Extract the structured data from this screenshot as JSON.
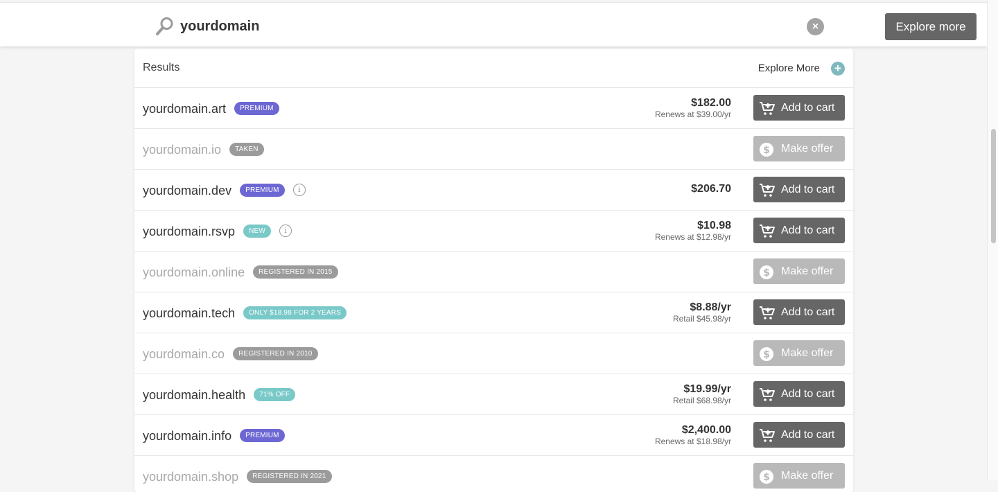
{
  "search": {
    "value": "yourdomain",
    "clear_symbol": "×"
  },
  "header": {
    "explore_button": "Explore more"
  },
  "results": {
    "title": "Results",
    "explore_link": "Explore More",
    "explore_plus": "+",
    "rows": [
      {
        "domain": "yourdomain.art",
        "badge": "PREMIUM",
        "badge_style": "premium",
        "info": false,
        "price": "$182.00",
        "sub": "Renews at $39.00/yr",
        "action": "Add to cart",
        "available": true
      },
      {
        "domain": "yourdomain.io",
        "badge": "TAKEN",
        "badge_style": "gray",
        "info": false,
        "price": "",
        "sub": "",
        "action": "Make offer",
        "available": false
      },
      {
        "domain": "yourdomain.dev",
        "badge": "PREMIUM",
        "badge_style": "premium",
        "info": true,
        "price": "$206.70",
        "sub": "",
        "action": "Add to cart",
        "available": true
      },
      {
        "domain": "yourdomain.rsvp",
        "badge": "NEW",
        "badge_style": "teal",
        "info": true,
        "price": "$10.98",
        "sub": "Renews at $12.98/yr",
        "action": "Add to cart",
        "available": true
      },
      {
        "domain": "yourdomain.online",
        "badge": "REGISTERED IN 2015",
        "badge_style": "gray",
        "info": false,
        "price": "",
        "sub": "",
        "action": "Make offer",
        "available": false
      },
      {
        "domain": "yourdomain.tech",
        "badge": "ONLY $18.98 FOR 2 YEARS",
        "badge_style": "teal",
        "info": false,
        "price": "$8.88/yr",
        "sub": "Retail $45.98/yr",
        "action": "Add to cart",
        "available": true
      },
      {
        "domain": "yourdomain.co",
        "badge": "REGISTERED IN 2010",
        "badge_style": "gray",
        "info": false,
        "price": "",
        "sub": "",
        "action": "Make offer",
        "available": false
      },
      {
        "domain": "yourdomain.health",
        "badge": "71% OFF",
        "badge_style": "teal",
        "info": false,
        "price": "$19.99/yr",
        "sub": "Retail $68.98/yr",
        "action": "Add to cart",
        "available": true
      },
      {
        "domain": "yourdomain.info",
        "badge": "PREMIUM",
        "badge_style": "premium",
        "info": false,
        "price": "$2,400.00",
        "sub": "Renews at $18.98/yr",
        "action": "Add to cart",
        "available": true
      },
      {
        "domain": "yourdomain.shop",
        "badge": "REGISTERED IN 2021",
        "badge_style": "gray",
        "info": false,
        "price": "",
        "sub": "",
        "action": "Make offer",
        "available": false
      }
    ]
  },
  "icons": {
    "search": "search-icon",
    "cart": "cart-icon",
    "offer": "dollar-coin-icon",
    "info": "info-icon",
    "clear": "close-icon",
    "plus": "plus-circle-icon"
  },
  "colors": {
    "premium": "#6d67d4",
    "teal": "#79c9c8",
    "gray_badge": "#9b9b9b",
    "primary_button": "#666666",
    "disabled_button": "#b9b9b9"
  }
}
